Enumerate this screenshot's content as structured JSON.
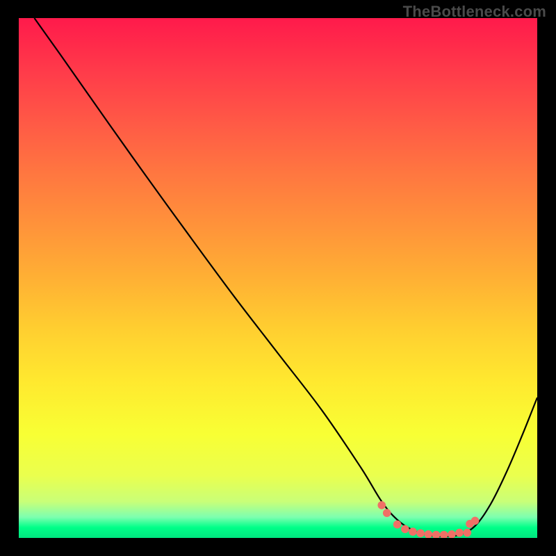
{
  "watermark": "TheBottleneck.com",
  "chart_data": {
    "type": "line",
    "title": "",
    "xlabel": "",
    "ylabel": "",
    "xlim": [
      0,
      100
    ],
    "ylim": [
      0,
      100
    ],
    "grid": false,
    "legend": false,
    "series": [
      {
        "name": "bottleneck-curve",
        "x": [
          3,
          8,
          17.5,
          25,
          33,
          41.5,
          50,
          58.5,
          66,
          70,
          73,
          76,
          79,
          82,
          85,
          88,
          91,
          94,
          97,
          100
        ],
        "y": [
          100,
          93,
          79.5,
          69,
          58,
          46.5,
          35.5,
          24.5,
          13.5,
          7,
          3.5,
          1.5,
          0.5,
          0.3,
          0.6,
          2.3,
          6.5,
          12.5,
          19.5,
          27
        ]
      }
    ],
    "markers": {
      "name": "optimal-range-dots",
      "color": "#f07066",
      "points": [
        {
          "x": 70.0,
          "y": 6.3
        },
        {
          "x": 71.0,
          "y": 4.8
        },
        {
          "x": 73.0,
          "y": 2.6
        },
        {
          "x": 74.5,
          "y": 1.7
        },
        {
          "x": 76.0,
          "y": 1.2
        },
        {
          "x": 77.5,
          "y": 0.9
        },
        {
          "x": 79.0,
          "y": 0.7
        },
        {
          "x": 80.5,
          "y": 0.6
        },
        {
          "x": 82.0,
          "y": 0.6
        },
        {
          "x": 83.5,
          "y": 0.7
        },
        {
          "x": 85.0,
          "y": 1.0
        },
        {
          "x": 86.5,
          "y": 1.0
        },
        {
          "x": 87.0,
          "y": 2.7
        },
        {
          "x": 88.0,
          "y": 3.3
        }
      ]
    },
    "gradient_stops": [
      {
        "pct": 0,
        "color": "#ff1a4b"
      },
      {
        "pct": 50,
        "color": "#ffb034"
      },
      {
        "pct": 85,
        "color": "#f2ff3c"
      },
      {
        "pct": 100,
        "color": "#00e680"
      }
    ]
  }
}
